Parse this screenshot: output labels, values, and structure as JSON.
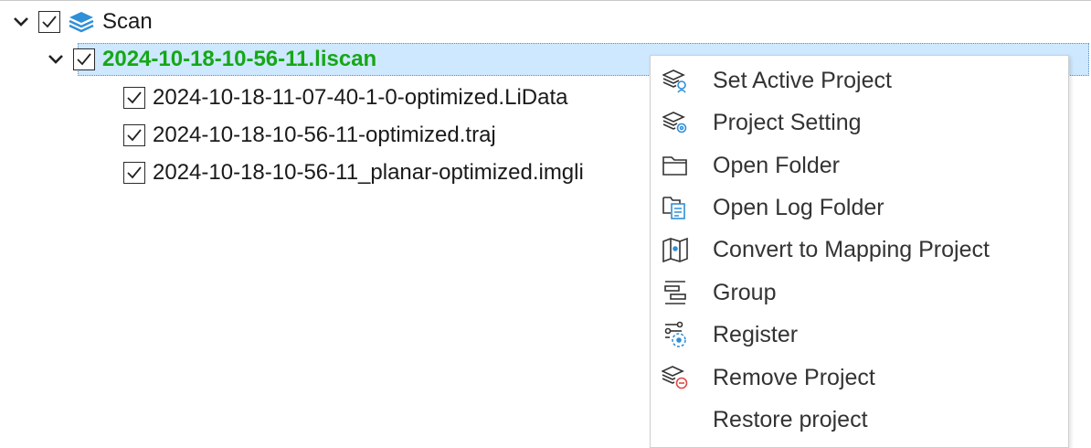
{
  "tree": {
    "root": {
      "label": "Scan",
      "checked": true,
      "icon": "layers-icon",
      "icon_color": "#2f8fd8"
    },
    "project": {
      "label": "2024-10-18-10-56-11.liscan",
      "checked": true,
      "label_color": "#16a716",
      "row_color": "#cde8ff"
    },
    "children": [
      {
        "label": "2024-10-18-11-07-40-1-0-optimized.LiData",
        "checked": true
      },
      {
        "label": "2024-10-18-10-56-11-optimized.traj",
        "checked": true
      },
      {
        "label": "2024-10-18-10-56-11_planar-optimized.imgli",
        "checked": true
      }
    ]
  },
  "context_menu": {
    "items": [
      {
        "label": "Set Active Project",
        "icon": "set-active-project-icon"
      },
      {
        "label": "Project Setting",
        "icon": "project-setting-icon"
      },
      {
        "label": "Open Folder",
        "icon": "folder-icon"
      },
      {
        "label": "Open Log Folder",
        "icon": "log-folder-icon"
      },
      {
        "label": "Convert to Mapping Project",
        "icon": "map-icon"
      },
      {
        "label": "Group",
        "icon": "group-icon"
      },
      {
        "label": "Register",
        "icon": "register-icon"
      },
      {
        "label": "Remove Project",
        "icon": "remove-project-icon"
      },
      {
        "label": "Restore project",
        "icon": ""
      }
    ]
  }
}
